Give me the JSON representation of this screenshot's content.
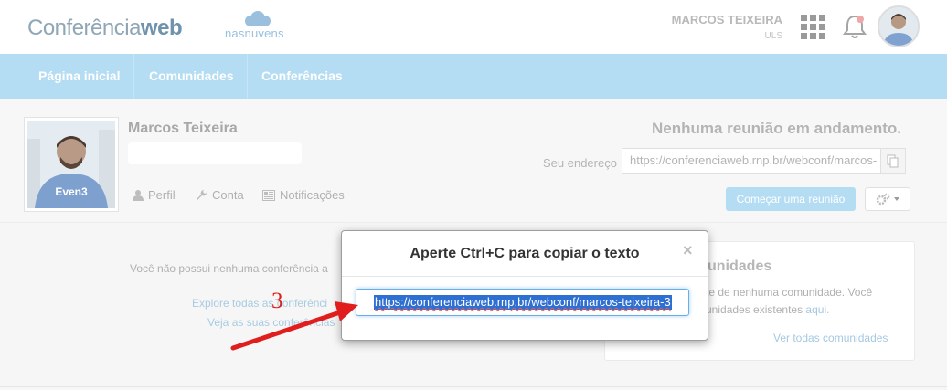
{
  "header": {
    "logo_light": "Conferência",
    "logo_bold": "web",
    "partner_logo": "nasnuvens",
    "user_name": "MARCOS TEIXEIRA",
    "user_org": "ULS"
  },
  "nav": {
    "items": [
      {
        "label": "Página inicial"
      },
      {
        "label": "Comunidades"
      },
      {
        "label": "Conferências"
      }
    ]
  },
  "profile": {
    "name": "Marcos Teixeira",
    "shirt_text": "Even3",
    "links": {
      "perfil": "Perfil",
      "conta": "Conta",
      "notificacoes": "Notificações"
    },
    "meeting_status": "Nenhuma reunião em andamento.",
    "address_label": "Seu endereço",
    "address_value": "https://conferenciaweb.rnp.br/webconf/marcos-",
    "start_button": "Começar uma reunião"
  },
  "content": {
    "no_conferences": "Você não possui nenhuma conferência a",
    "explore_link": "Explore todas as conferênci",
    "view_link": "Veja as suas conferências"
  },
  "communities_card": {
    "title_fragment": "unidades",
    "line1": "te de nenhuma comunidade. Você",
    "line2_text": "unidades existentes",
    "line2_link": "aqui.",
    "see_all": "Ver todas comunidades"
  },
  "modal": {
    "title": "Aperte Ctrl+C para copiar o texto",
    "close": "×",
    "input_value": "https://conferenciaweb.rnp.br/webconf/marcos-teixeira-3"
  },
  "annotation": {
    "number": "3",
    "color": "#e01e1e"
  },
  "colors": {
    "nav_bg": "#b4dcf3",
    "accent_button": "#b4dcf3",
    "selection": "#2e6fd2"
  }
}
